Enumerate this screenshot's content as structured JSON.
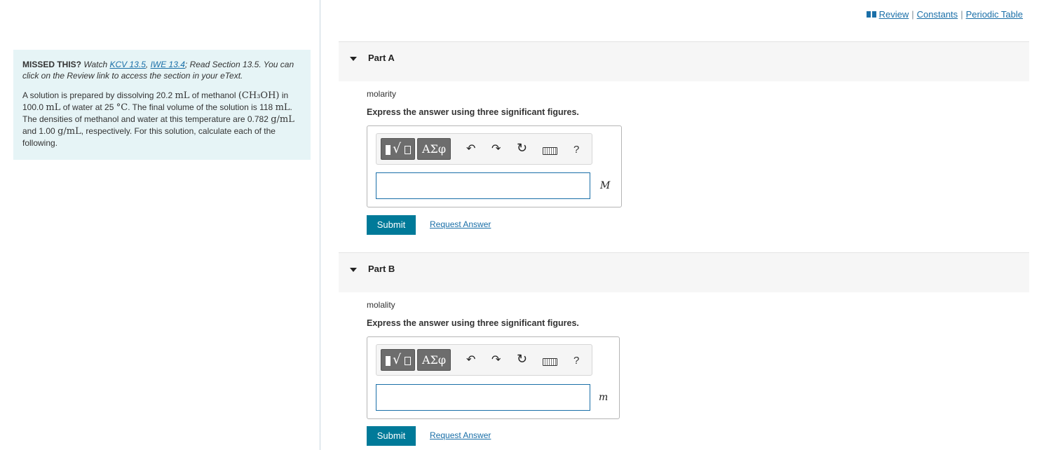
{
  "top_links": {
    "review": "Review",
    "sep1": "|",
    "constants": "Constants",
    "sep2": "|",
    "periodic_table": "Periodic Table"
  },
  "problem": {
    "missed_prefix": "MISSED THIS?",
    "watch": "Watch",
    "kcv_link": "KCV 13.5",
    "comma": ",",
    "iwe_link": "IWE 13.4",
    "read_text": "; Read Section 13.5. You can click on the Review link to access the section in your eText.",
    "s1": "A solution is prepared by dissolving 20.2",
    "u_mL": "mL",
    "s2": "of methanol",
    "formula": "(CH₃OH)",
    "s3": "in 100.0",
    "s4": "of water at 25",
    "u_degC": "°C",
    "s5": ". The final volume of the solution is 118",
    "s6": ". The densities of methanol and water at this temperature are 0.782",
    "u_gmL": "g/mL",
    "s7": "and 1.00",
    "s8": ", respectively. For this solution, calculate each of the following."
  },
  "toolbar": {
    "greek": "ΑΣφ",
    "sqrt": "√",
    "undo": "↶",
    "redo": "↷",
    "reset": "↻",
    "help": "?"
  },
  "part_a": {
    "title": "Part A",
    "label": "molarity",
    "instruction": "Express the answer using three significant figures.",
    "unit": "M",
    "value": "",
    "submit": "Submit",
    "request": "Request Answer"
  },
  "part_b": {
    "title": "Part B",
    "label": "molality",
    "instruction": "Express the answer using three significant figures.",
    "unit": "m",
    "value": "",
    "submit": "Submit",
    "request": "Request Answer"
  }
}
